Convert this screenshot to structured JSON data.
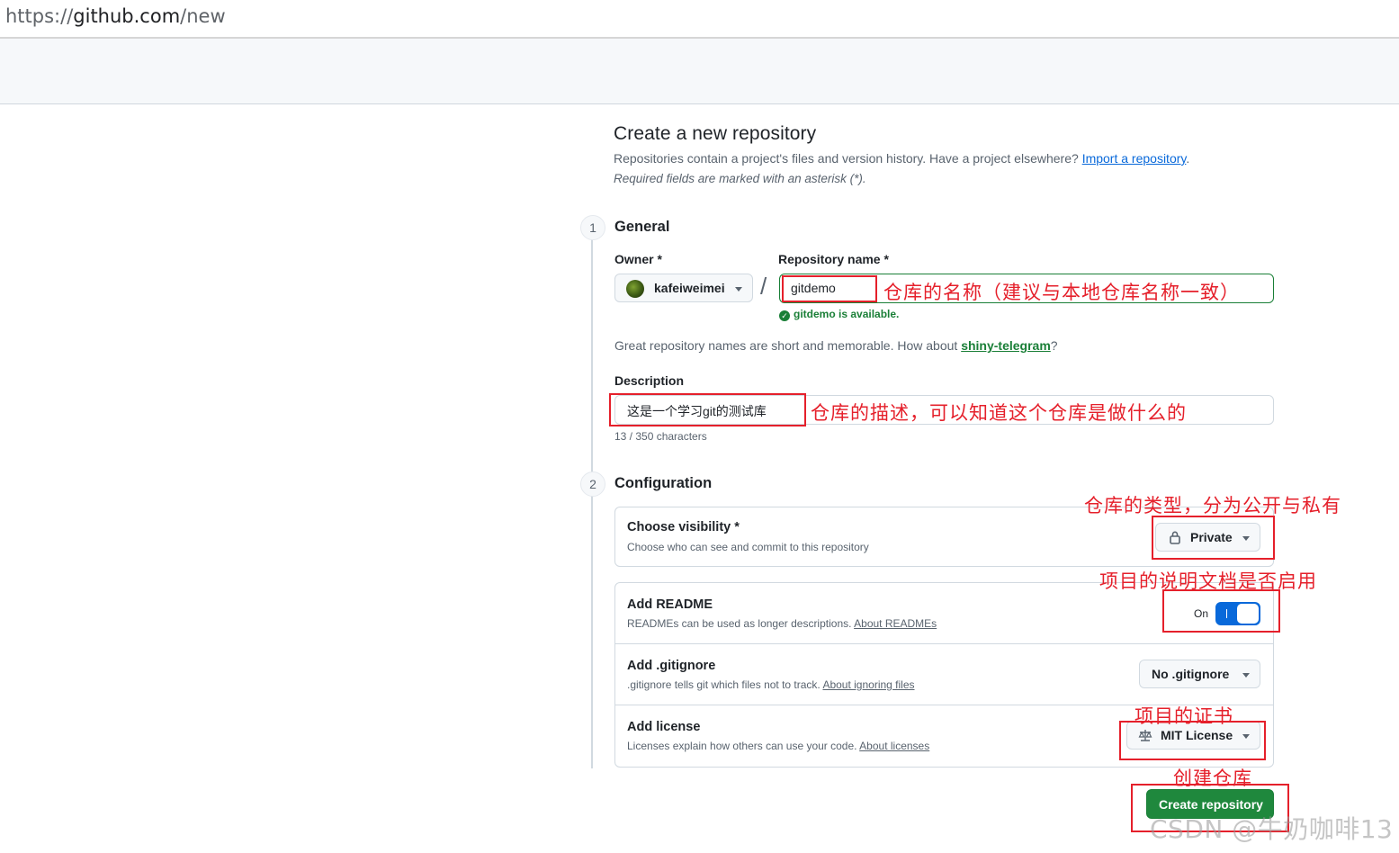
{
  "browser": {
    "url_scheme": "https://",
    "url_host": "github.com",
    "url_path": "/new"
  },
  "page": {
    "title": "Create a new repository",
    "subtitle": "Repositories contain a project's files and version history. Have a project elsewhere?",
    "import_link": "Import a repository",
    "subtitle_end": ".",
    "required_note": "Required fields are marked with an asterisk (*)."
  },
  "general": {
    "step": "1",
    "title": "General",
    "owner_label": "Owner *",
    "owner_value": "kafeiweimei",
    "slash": "/",
    "repo_label": "Repository name *",
    "repo_value": "gitdemo",
    "available": "gitdemo is available.",
    "great_prefix": "Great repository names are short and memorable. How about",
    "suggestion": "shiny-telegram",
    "great_suffix": "?",
    "description_label": "Description",
    "description_value": "这是一个学习git的测试库",
    "char_count": "13 / 350 characters"
  },
  "configuration": {
    "step": "2",
    "title": "Configuration",
    "visibility_title": "Choose visibility *",
    "visibility_desc": "Choose who can see and commit to this repository",
    "visibility_value": "Private",
    "readme_title": "Add README",
    "readme_desc": "READMEs can be used as longer descriptions.",
    "readme_link": "About READMEs",
    "readme_toggle_label": "On",
    "readme_enabled": true,
    "gitignore_title": "Add .gitignore",
    "gitignore_desc": ".gitignore tells git which files not to track.",
    "gitignore_link": "About ignoring files",
    "gitignore_value": "No .gitignore",
    "license_title": "Add license",
    "license_desc": "Licenses explain how others can use your code.",
    "license_link": "About licenses",
    "license_value": "MIT License"
  },
  "actions": {
    "create_label": "Create repository"
  },
  "annotations": {
    "repo_name": "仓库的名称（建议与本地仓库名称一致）",
    "description": "仓库的描述，可以知道这个仓库是做什么的",
    "visibility": "仓库的类型，分为公开与私有",
    "readme": "项目的说明文档是否启用",
    "license": "项目的证书",
    "create": "创建仓库"
  },
  "watermark": "CSDN @牛奶咖啡13",
  "colors": {
    "annotation_red": "#e5202b",
    "primary_green": "#1f883d",
    "toggle_blue": "#0969da",
    "link_blue": "#0969da"
  }
}
